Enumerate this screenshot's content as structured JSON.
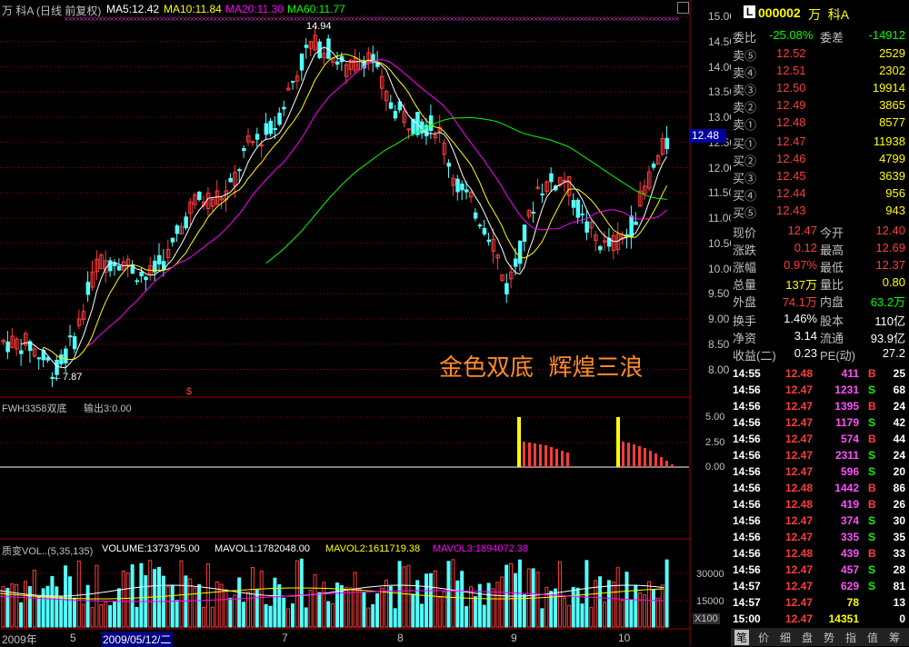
{
  "header": {
    "stock": "万 科A (日线 前复权)",
    "ma5": "MA5:12.42",
    "ma10": "MA10:11.84",
    "ma20": "MA20:11.30",
    "ma60": "MA60:11.77"
  },
  "price_axis": [
    "15.00",
    "14.50",
    "14.00",
    "13.50",
    "13.00",
    "12.50",
    "12.00",
    "11.50",
    "11.00",
    "10.50",
    "10.00",
    "9.50",
    "9.00",
    "8.50",
    "8.00"
  ],
  "current_price_tag": "12.48",
  "annotations": {
    "high": "14.94",
    "low": "←7.87",
    "dollar": "$",
    "slogan": "金色双底  辉煌三浪"
  },
  "indicator": {
    "title": "FWH3358双底",
    "output": "输出3:0.00",
    "axis": [
      "5.00",
      "2.50",
      "0.00"
    ]
  },
  "volume": {
    "title": "质变VOL..(5,35,135)",
    "volume": "VOLUME:1373795.00",
    "mavol1": "MAVOL1:1782048.00",
    "mavol2": "MAVOL2:1611719.38",
    "mavol3": "MAVOL3:1894072.38",
    "axis": [
      "30000",
      "15000"
    ],
    "unit": "X100"
  },
  "date_axis": {
    "year": "2009年",
    "m5": "5",
    "cursor_date": "2009/05/12/二",
    "m7": "7",
    "m8": "8",
    "m9": "9",
    "m10": "10"
  },
  "quote": {
    "badge": "L",
    "code": "000002",
    "name": "万  科A",
    "weibi_label": "委比",
    "weibi": "-25.08%",
    "weicha_label": "委差",
    "weicha": "-14912",
    "sells": [
      {
        "label": "卖⑤",
        "price": "12.52",
        "vol": "2529"
      },
      {
        "label": "卖④",
        "price": "12.51",
        "vol": "2302"
      },
      {
        "label": "卖③",
        "price": "12.50",
        "vol": "19914"
      },
      {
        "label": "卖②",
        "price": "12.49",
        "vol": "3865"
      },
      {
        "label": "卖①",
        "price": "12.48",
        "vol": "8577"
      }
    ],
    "buys": [
      {
        "label": "买①",
        "price": "12.47",
        "vol": "11938"
      },
      {
        "label": "买②",
        "price": "12.46",
        "vol": "4799"
      },
      {
        "label": "买③",
        "price": "12.45",
        "vol": "3639"
      },
      {
        "label": "买④",
        "price": "12.44",
        "vol": "956"
      },
      {
        "label": "买⑤",
        "price": "12.43",
        "vol": "943"
      }
    ],
    "stats": [
      {
        "l1": "现价",
        "v1": "12.47",
        "l2": "今开",
        "v2": "12.40"
      },
      {
        "l1": "涨跌",
        "v1": "0.12",
        "l2": "最高",
        "v2": "12.69"
      },
      {
        "l1": "涨幅",
        "v1": "0.97%",
        "l2": "最低",
        "v2": "12.37"
      },
      {
        "l1": "总量",
        "v1": "137万",
        "l2": "量比",
        "v2": "0.80"
      },
      {
        "l1": "外盘",
        "v1": "74.1万",
        "l2": "内盘",
        "v2": "63.2万"
      }
    ],
    "stats2": [
      {
        "l1": "换手",
        "v1": "1.46%",
        "l2": "股本",
        "v2": "110亿"
      },
      {
        "l1": "净资",
        "v1": "3.14",
        "l2": "流通",
        "v2": "93.9亿"
      },
      {
        "l1": "收益(二)",
        "v1": "0.23",
        "l2": "PE(动)",
        "v2": "27.2"
      }
    ],
    "ticks": [
      {
        "t": "14:55",
        "p": "12.48",
        "v": "411",
        "d": "B",
        "n": "25"
      },
      {
        "t": "14:56",
        "p": "12.47",
        "v": "1231",
        "d": "S",
        "n": "68"
      },
      {
        "t": "14:56",
        "p": "12.47",
        "v": "1395",
        "d": "B",
        "n": "24"
      },
      {
        "t": "14:56",
        "p": "12.47",
        "v": "1179",
        "d": "S",
        "n": "42"
      },
      {
        "t": "14:56",
        "p": "12.47",
        "v": "574",
        "d": "B",
        "n": "44"
      },
      {
        "t": "14:56",
        "p": "12.47",
        "v": "2311",
        "d": "S",
        "n": "24"
      },
      {
        "t": "14:56",
        "p": "12.47",
        "v": "596",
        "d": "S",
        "n": "20"
      },
      {
        "t": "14:56",
        "p": "12.48",
        "v": "1442",
        "d": "B",
        "n": "86"
      },
      {
        "t": "14:56",
        "p": "12.48",
        "v": "419",
        "d": "B",
        "n": "26"
      },
      {
        "t": "14:56",
        "p": "12.47",
        "v": "374",
        "d": "S",
        "n": "30"
      },
      {
        "t": "14:56",
        "p": "12.47",
        "v": "335",
        "d": "S",
        "n": "35"
      },
      {
        "t": "14:56",
        "p": "12.48",
        "v": "439",
        "d": "B",
        "n": "33"
      },
      {
        "t": "14:56",
        "p": "12.47",
        "v": "457",
        "d": "S",
        "n": "28"
      },
      {
        "t": "14:57",
        "p": "12.47",
        "v": "629",
        "d": "S",
        "n": "81"
      },
      {
        "t": "14:57",
        "p": "12.47",
        "v": "78",
        "d": "",
        "n": "13"
      },
      {
        "t": "15:00",
        "p": "12.47",
        "v": "14351",
        "d": "",
        "n": "0"
      }
    ],
    "tabs": [
      "笔",
      "价",
      "细",
      "盘",
      "势",
      "指",
      "值",
      "筹"
    ]
  },
  "colors": {
    "up": "#ff3c3c",
    "down": "#54ffff",
    "ma5": "#ffffff",
    "ma10": "#ffff00",
    "ma20": "#ff00ff",
    "ma60": "#00ff00",
    "grid": "#a00000",
    "slogan": "#ff8c28"
  }
}
